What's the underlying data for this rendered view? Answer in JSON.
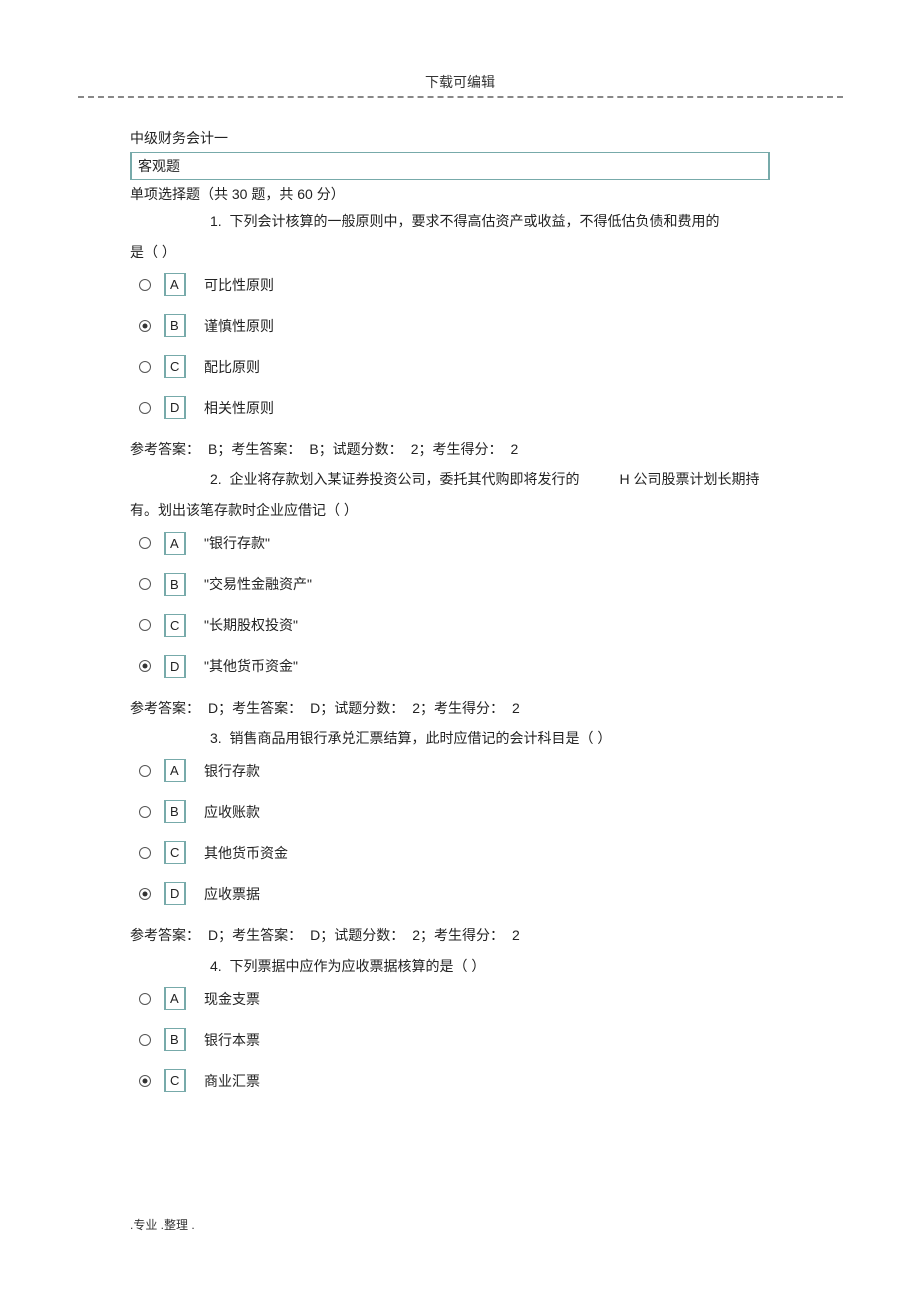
{
  "page": {
    "header": "下载可编辑",
    "doc_title": "中级财务会计一",
    "section_header": "客观题",
    "sub_header": "单项选择题（共    30 题，共  60 分）",
    "footer": ".专业 .整理 ."
  },
  "questions": [
    {
      "num": "1.",
      "text_prefix": "下列会计核算的一般原则中，要求不得高估资产或收益，不得低估负债和费用的",
      "text_suffix": "是（  ）",
      "options": [
        {
          "letter": "A",
          "text": "可比性原则",
          "selected": false
        },
        {
          "letter": "B",
          "text": "谨慎性原则",
          "selected": true
        },
        {
          "letter": "C",
          "text": "配比原则",
          "selected": false
        },
        {
          "letter": "D",
          "text": "相关性原则",
          "selected": false
        }
      ],
      "answer": {
        "ref": "B",
        "stu": "B",
        "pts": "2",
        "score": "2"
      }
    },
    {
      "num": "2.",
      "text_prefix": "企业将存款划入某证券投资公司，委托其代购即将发行的",
      "text_mid_gap": true,
      "text_mid": "H 公司股票计划长期持",
      "text_suffix": "有。划出该笔存款时企业应借记（      ）",
      "options": [
        {
          "letter": "A",
          "text": "\"银行存款\"",
          "selected": false
        },
        {
          "letter": "B",
          "text": "\"交易性金融资产\"",
          "selected": false
        },
        {
          "letter": "C",
          "text": "\"长期股权投资\"",
          "selected": false
        },
        {
          "letter": "D",
          "text": "\"其他货币资金\"",
          "selected": true
        }
      ],
      "answer": {
        "ref": "D",
        "stu": "D",
        "pts": "2",
        "score": "2"
      }
    },
    {
      "num": "3.",
      "text_prefix": "销售商品用银行承兑汇票结算，此时应借记的会计科目是（           ）",
      "text_suffix": "",
      "options": [
        {
          "letter": "A",
          "text": "银行存款",
          "selected": false
        },
        {
          "letter": "B",
          "text": "应收账款",
          "selected": false
        },
        {
          "letter": "C",
          "text": "其他货币资金",
          "selected": false
        },
        {
          "letter": "D",
          "text": "应收票据",
          "selected": true
        }
      ],
      "answer": {
        "ref": "D",
        "stu": "D",
        "pts": "2",
        "score": "2"
      }
    },
    {
      "num": "4.",
      "text_prefix": "下列票据中应作为应收票据核算的是（        ）",
      "text_suffix": "",
      "options": [
        {
          "letter": "A",
          "text": "现金支票",
          "selected": false
        },
        {
          "letter": "B",
          "text": "银行本票",
          "selected": false
        },
        {
          "letter": "C",
          "text": "商业汇票",
          "selected": true
        }
      ]
    }
  ],
  "labels": {
    "ref_answer": "参考答案：",
    "stu_answer": "；考生答案：",
    "pts": "；试题分数：",
    "score": "；考生得分："
  }
}
